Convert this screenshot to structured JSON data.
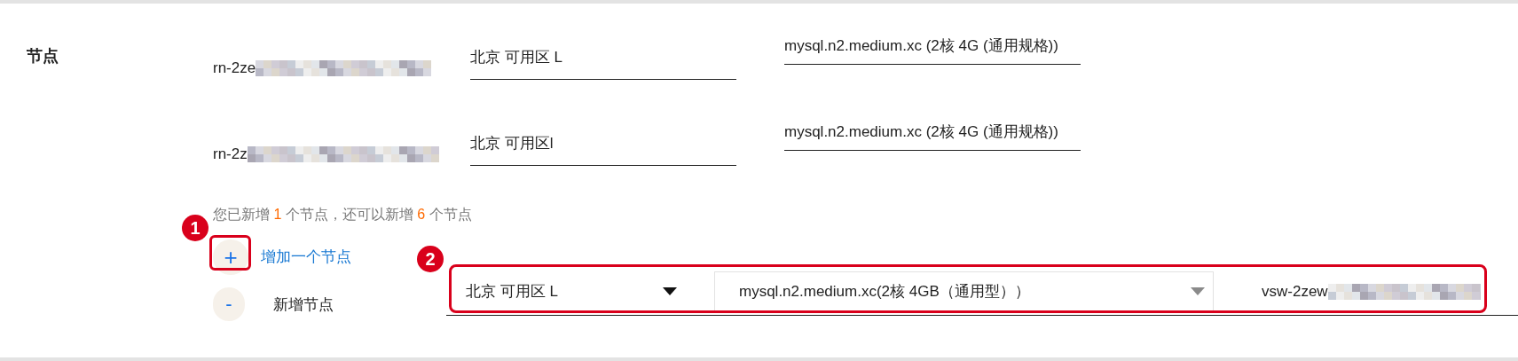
{
  "section_label": "节点",
  "existing_nodes": [
    {
      "id": "rn-2ze",
      "zone": "北京 可用区 L",
      "spec": "mysql.n2.medium.xc (2核 4G (通用规格))"
    },
    {
      "id": "rn-2z",
      "zone": "北京 可用区l",
      "spec": "mysql.n2.medium.xc (2核 4G (通用规格))"
    }
  ],
  "quota_note": [
    {
      "kind": "text",
      "text": "您已新增"
    },
    {
      "kind": "count",
      "text": "1"
    },
    {
      "kind": "text",
      "text": "个节点，还可以新增"
    },
    {
      "kind": "count",
      "text": "6"
    },
    {
      "kind": "text",
      "text": "个节点"
    }
  ],
  "add_node": {
    "icon": "+",
    "label": "增加一个节点"
  },
  "new_node": {
    "remove_icon": "-",
    "label": "新增节点",
    "zone": "北京 可用区 L",
    "spec": "mysql.n2.medium.xc(2核 4GB（通用型））",
    "vswitch": "vsw-2zew"
  },
  "annotations": [
    {
      "label": "1"
    },
    {
      "label": "2"
    }
  ]
}
